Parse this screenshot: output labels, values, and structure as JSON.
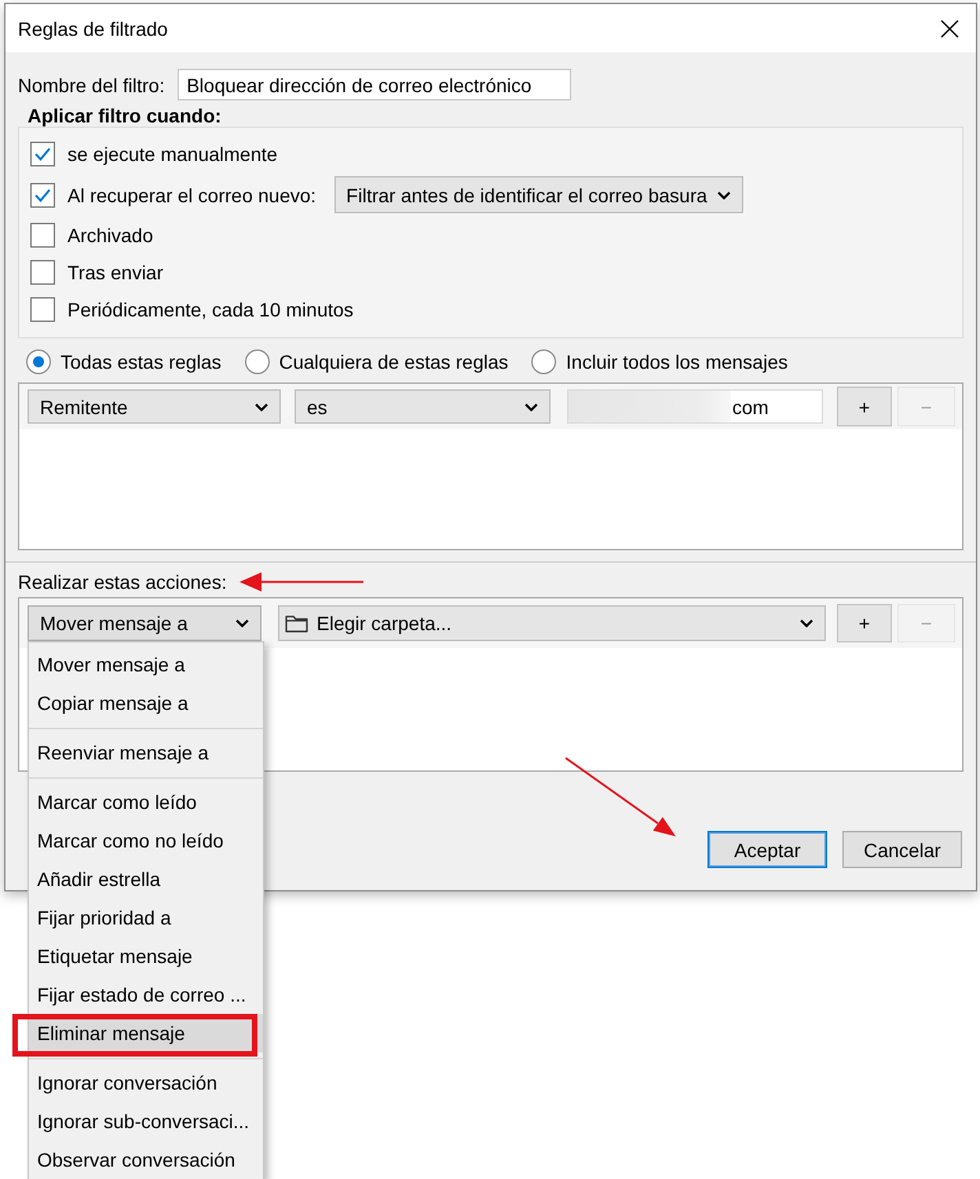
{
  "window": {
    "title": "Reglas de filtrado"
  },
  "filter_name": {
    "label": "Nombre del filtro:",
    "value": "Bloquear dirección de correo electrónico"
  },
  "apply_when": {
    "heading": "Aplicar filtro cuando:",
    "options": [
      {
        "label": "se ejecute manualmente",
        "checked": true
      },
      {
        "label": "Al recuperar el correo nuevo:",
        "checked": true,
        "dropdown": "Filtrar antes de identificar el correo basura"
      },
      {
        "label": "Archivado",
        "checked": false
      },
      {
        "label": "Tras enviar",
        "checked": false
      },
      {
        "label": "Periódicamente, cada 10 minutos",
        "checked": false
      }
    ]
  },
  "match_mode": [
    {
      "label": "Todas estas reglas",
      "selected": true
    },
    {
      "label": "Cualquiera de estas reglas",
      "selected": false
    },
    {
      "label": "Incluir todos los mensajes",
      "selected": false
    }
  ],
  "rules": [
    {
      "field": "Remitente",
      "operator": "es",
      "value": "com",
      "value_redacted": true,
      "buttons": [
        {
          "label": "+",
          "disabled": false
        },
        {
          "label": "−",
          "disabled": true
        }
      ]
    }
  ],
  "actions": {
    "heading": "Realizar estas acciones:",
    "annotation_arrow": true,
    "rows": [
      {
        "action": "Mover mensaje a",
        "expanded": true,
        "target": "Elegir carpeta...",
        "buttons": [
          {
            "label": "+",
            "disabled": false
          },
          {
            "label": "−",
            "disabled": true
          }
        ],
        "menu": [
          {
            "items": [
              {
                "label": "Mover mensaje a",
                "selected": false,
                "annotation_box": false
              },
              {
                "label": "Copiar mensaje a",
                "selected": false,
                "annotation_box": false
              }
            ]
          },
          {
            "items": [
              {
                "label": "Reenviar mensaje a",
                "selected": false,
                "annotation_box": false
              }
            ]
          },
          {
            "items": [
              {
                "label": "Marcar como leído",
                "selected": false,
                "annotation_box": false
              },
              {
                "label": "Marcar como no leído",
                "selected": false,
                "annotation_box": false
              },
              {
                "label": "Añadir estrella",
                "selected": false,
                "annotation_box": false
              },
              {
                "label": "Fijar prioridad a",
                "selected": false,
                "annotation_box": false
              },
              {
                "label": "Etiquetar mensaje",
                "selected": false,
                "annotation_box": false
              },
              {
                "label": "Fijar estado de correo ...",
                "selected": false,
                "annotation_box": false
              },
              {
                "label": "Eliminar mensaje",
                "selected": true,
                "annotation_box": true
              }
            ]
          },
          {
            "items": [
              {
                "label": "Ignorar conversación",
                "selected": false,
                "annotation_box": false
              },
              {
                "label": "Ignorar sub-conversaci...",
                "selected": false,
                "annotation_box": false
              },
              {
                "label": "Observar conversación",
                "selected": false,
                "annotation_box": false
              }
            ]
          }
        ]
      }
    ]
  },
  "buttons": [
    {
      "label": "Aceptar",
      "default": true,
      "annotation_arrow": true
    },
    {
      "label": "Cancelar",
      "default": false,
      "annotation_arrow": false
    }
  ]
}
